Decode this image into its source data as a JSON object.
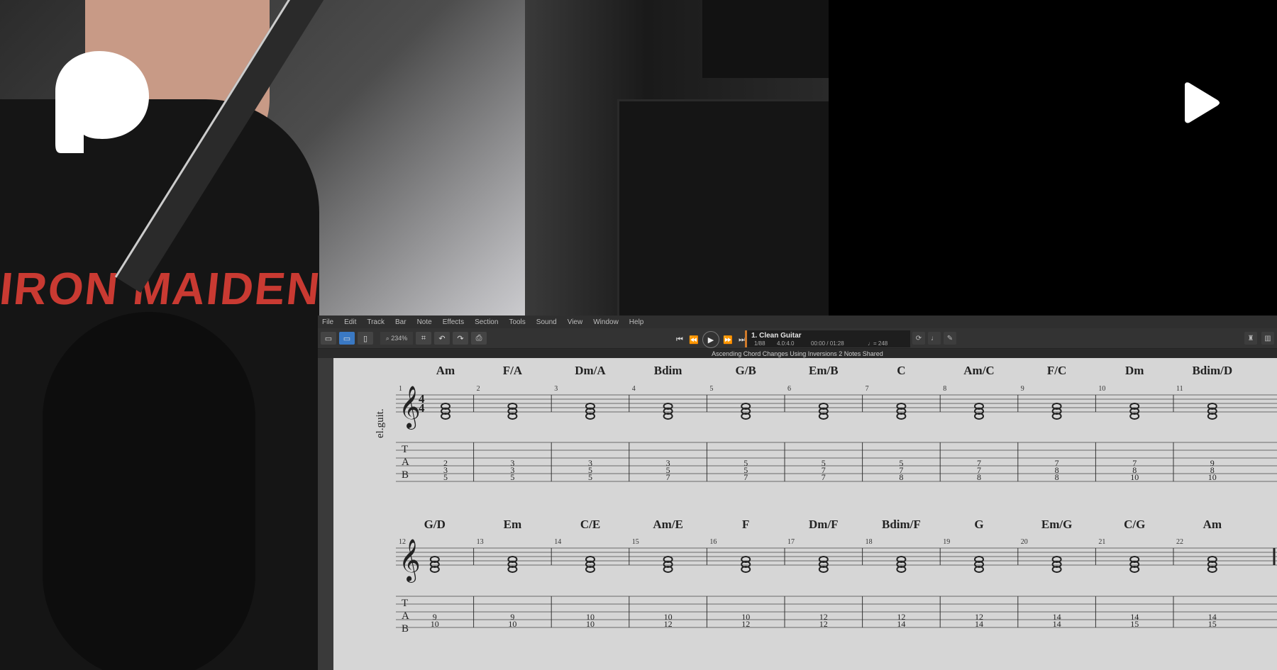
{
  "video": {
    "shirt_text": "IRON MAIDEN",
    "logo_icon": "patreon-logo-icon",
    "play_icon": "play-icon"
  },
  "app": {
    "menu": [
      "File",
      "Edit",
      "Track",
      "Bar",
      "Note",
      "Effects",
      "Section",
      "Tools",
      "Sound",
      "View",
      "Window",
      "Help"
    ],
    "zoom": "234%",
    "track_name": "1. Clean Guitar",
    "bar_position": "1/88",
    "time_signature": "4.0:4.0",
    "time": "00:00 / 01:28",
    "tempo": "♩= 248",
    "document_title": "Ascending Chord Changes Using Inversions 2 Notes Shared",
    "colors": {
      "accent": "#3a79c4",
      "track_marker": "#d07a2a"
    }
  },
  "score": {
    "instrument_label": "el.guit.",
    "tab_letters": [
      "T",
      "A",
      "B"
    ],
    "time_signature": [
      "4",
      "4"
    ],
    "system1": {
      "measure_numbers": [
        "1",
        "2",
        "3",
        "4",
        "5",
        "6",
        "7",
        "8",
        "9",
        "10",
        "11"
      ],
      "chords": [
        "Am",
        "F/A",
        "Dm/A",
        "Bdim",
        "G/B",
        "Em/B",
        "C",
        "Am/C",
        "F/C",
        "Dm",
        "Bdim/D"
      ],
      "tab": [
        [
          "2",
          "3",
          "5"
        ],
        [
          "3",
          "3",
          "5"
        ],
        [
          "3",
          "5",
          "5"
        ],
        [
          "3",
          "5",
          "7"
        ],
        [
          "5",
          "5",
          "7"
        ],
        [
          "5",
          "7",
          "7"
        ],
        [
          "5",
          "7",
          "8"
        ],
        [
          "7",
          "7",
          "8"
        ],
        [
          "7",
          "8",
          "8"
        ],
        [
          "7",
          "8",
          "10"
        ],
        [
          "9",
          "8",
          "10"
        ]
      ]
    },
    "system2": {
      "measure_numbers": [
        "12",
        "13",
        "14",
        "15",
        "16",
        "17",
        "18",
        "19",
        "20",
        "21",
        "22"
      ],
      "chords": [
        "G/D",
        "Em",
        "C/E",
        "Am/E",
        "F",
        "Dm/F",
        "Bdim/F",
        "G",
        "Em/G",
        "C/G",
        "Am"
      ],
      "tab": [
        [
          "9",
          "10"
        ],
        [
          "9",
          "10"
        ],
        [
          "10",
          "10"
        ],
        [
          "10",
          "12"
        ],
        [
          "10",
          "12"
        ],
        [
          "12",
          "12"
        ],
        [
          "12",
          "14"
        ],
        [
          "12",
          "14"
        ],
        [
          "14",
          "14"
        ],
        [
          "14",
          "15"
        ],
        [
          "14",
          "15"
        ]
      ]
    }
  }
}
